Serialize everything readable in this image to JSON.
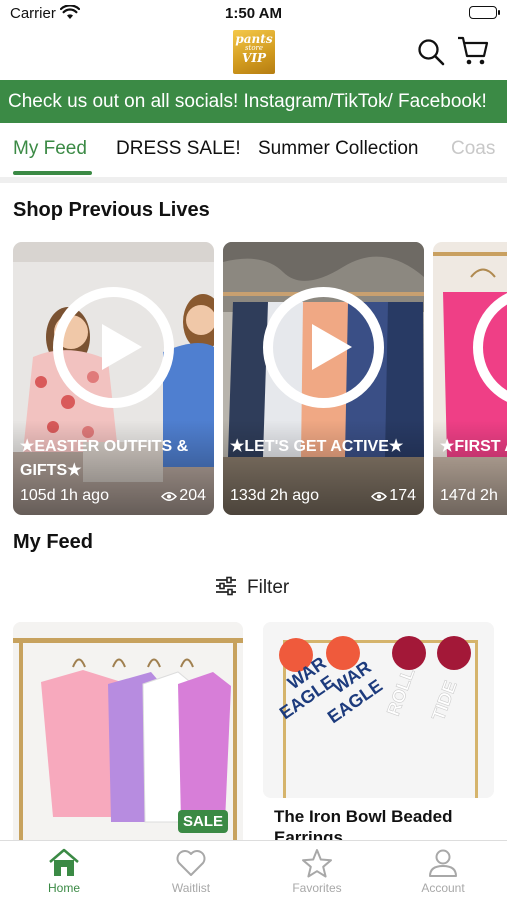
{
  "status_bar": {
    "carrier": "Carrier",
    "time": "1:50 AM"
  },
  "header": {
    "logo": {
      "line1": "pants",
      "line2": "store",
      "line3": "VIP"
    }
  },
  "banner": {
    "text": "Check us out on all socials! Instagram/TikTok/ Facebook!"
  },
  "tabs": [
    "My Feed",
    "DRESS SALE!",
    "Summer Collection",
    "Coas"
  ],
  "active_tab": "My Feed",
  "shop_previous_lives": {
    "title": "Shop Previous Lives",
    "cards": [
      {
        "title": "★EASTER OUTFITS & GIFTS★",
        "age": "105d 1h ago",
        "views": "204"
      },
      {
        "title": "★LET'S GET ACTIVE★",
        "age": "133d 2h ago",
        "views": "174"
      },
      {
        "title": "★FIRST A WHILE",
        "age": "147d 2h",
        "views": ""
      }
    ]
  },
  "my_feed": {
    "title": "My Feed",
    "filter_label": "Filter",
    "products": [
      {
        "name": "",
        "badge": "SALE"
      },
      {
        "name": "The Iron Bowl Beaded Earrings",
        "badge": ""
      }
    ],
    "earring_text": [
      "WAR",
      "EAGLE",
      "ROLL",
      "TIDE"
    ]
  },
  "bottom_nav": [
    {
      "label": "Home",
      "icon": "home-icon",
      "active": true
    },
    {
      "label": "Waitlist",
      "icon": "heart-icon",
      "active": false
    },
    {
      "label": "Favorites",
      "icon": "star-icon",
      "active": false
    },
    {
      "label": "Account",
      "icon": "person-icon",
      "active": false
    }
  ],
  "colors": {
    "brand_green": "#3b8a45",
    "logo_gold": "#d19a1e",
    "inactive_nav": "#a8a8a8"
  }
}
